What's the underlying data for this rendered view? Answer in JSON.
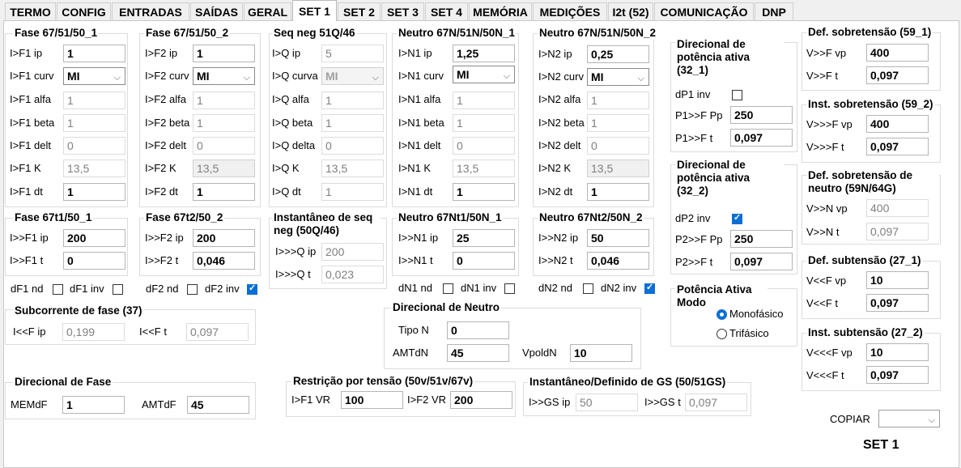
{
  "tabs": [
    "TERMO",
    "CONFIG",
    "ENTRADAS",
    "SAÍDAS",
    "GERAL",
    "SET 1",
    "SET 2",
    "SET 3",
    "SET 4",
    "MEMÓRIA",
    "MEDIÇÕES",
    "I2t (52)",
    "COMUNICAÇÃO",
    "DNP"
  ],
  "active_tab": "SET 1",
  "groups": {
    "f1": {
      "title": "Fase 67/51/50_1",
      "rows": [
        [
          "I>F1 ip",
          "1"
        ],
        [
          "I>F1 curv",
          "MI"
        ],
        [
          "I>F1 alfa",
          "1"
        ],
        [
          "I>F1 beta",
          "1"
        ],
        [
          "I>F1 delt",
          "0"
        ],
        [
          "I>F1 K",
          "13,5"
        ],
        [
          "I>F1 dt",
          "1"
        ]
      ]
    },
    "f2": {
      "title": "Fase 67/51/50_2",
      "rows": [
        [
          "I>F2 ip",
          "1"
        ],
        [
          "I>F2 curv",
          "MI"
        ],
        [
          "I>F2 alfa",
          "1"
        ],
        [
          "I>F2 beta",
          "1"
        ],
        [
          "I>F2 delt",
          "0"
        ],
        [
          "I>F2 K",
          "13,5"
        ],
        [
          "I>F2 dt",
          "1"
        ]
      ]
    },
    "q": {
      "title": "Seq neg 51Q/46",
      "rows": [
        [
          "I>Q ip",
          "5"
        ],
        [
          "I>Q curva",
          "MI"
        ],
        [
          "I>Q alfa",
          "1"
        ],
        [
          "I>Q beta",
          "1"
        ],
        [
          "I>Q delta",
          "0"
        ],
        [
          "I>Q K",
          "13,5"
        ],
        [
          "I>Q dt",
          "1"
        ]
      ]
    },
    "n1": {
      "title": "Neutro 67N/51N/50N_1",
      "rows": [
        [
          "I>N1 ip",
          "1,25"
        ],
        [
          "I>N1 curv",
          "MI"
        ],
        [
          "I>N1 alfa",
          "1"
        ],
        [
          "I>N1 beta",
          "1"
        ],
        [
          "I>N1 delt",
          "0"
        ],
        [
          "I>N1 K",
          "13,5"
        ],
        [
          "I>N1 dt",
          "1"
        ]
      ]
    },
    "n2": {
      "title": "Neutro 67N/51N/50N_2",
      "rows": [
        [
          "I>N2 ip",
          "0,25"
        ],
        [
          "I>N2 curv",
          "MI"
        ],
        [
          "I>N2 alfa",
          "1"
        ],
        [
          "I>N2 beta",
          "1"
        ],
        [
          "I>N2 delt",
          "0"
        ],
        [
          "I>N2 K",
          "13,5"
        ],
        [
          "I>N2 dt",
          "1"
        ]
      ]
    },
    "ft1": {
      "title": "Fase 67t1/50_1",
      "rows": [
        [
          "I>>F1 ip",
          "200"
        ],
        [
          "I>>F1 t",
          "0"
        ]
      ]
    },
    "ft2": {
      "title": "Fase 67t2/50_2",
      "rows": [
        [
          "I>>F2 ip",
          "200"
        ],
        [
          "I>>F2 t",
          "0,046"
        ]
      ]
    },
    "qi": {
      "title": "Instantâneo de seq neg (50Q/46)",
      "rows": [
        [
          "I>>>Q ip",
          "200"
        ],
        [
          "I>>>Q t",
          "0,023"
        ]
      ]
    },
    "nt1": {
      "title": "Neutro 67Nt1/50N_1",
      "rows": [
        [
          "I>>N1 ip",
          "25"
        ],
        [
          "I>>N1 t",
          "0"
        ]
      ]
    },
    "nt2": {
      "title": "Neutro 67Nt2/50N_2",
      "rows": [
        [
          "I>>N2 ip",
          "50"
        ],
        [
          "I>>N2 t",
          "0,046"
        ]
      ]
    },
    "dp1": {
      "title": "Direcional de potência ativa (32_1)",
      "chk": "dP1 inv",
      "rows": [
        [
          "P1>>F Pp",
          "250"
        ],
        [
          "P1>>F t",
          "0,097"
        ]
      ]
    },
    "dp2": {
      "title": "Direcional de potência ativa (32_2)",
      "chk": "dP2 inv",
      "rows": [
        [
          "P2>>F Pp",
          "250"
        ],
        [
          "P2>>F t",
          "0,097"
        ]
      ]
    },
    "pam": {
      "title": "Potência Ativa Modo",
      "opt1": "Monofásico",
      "opt2": "Trifásico"
    },
    "s591": {
      "title": "Def. sobretensão (59_1)",
      "rows": [
        [
          "V>>F vp",
          "400"
        ],
        [
          "V>>F t",
          "0,097"
        ]
      ]
    },
    "s592": {
      "title": "Inst. sobretensão (59_2)",
      "rows": [
        [
          "V>>>F vp",
          "400"
        ],
        [
          "V>>>F t",
          "0,097"
        ]
      ]
    },
    "s59n": {
      "title": "Def. sobretensão de neutro (59N/64G)",
      "rows": [
        [
          "V>>N vp",
          "400"
        ],
        [
          "V>>N t",
          "0,097"
        ]
      ]
    },
    "s271": {
      "title": "Def. subtensão (27_1)",
      "rows": [
        [
          "V<<F vp",
          "10"
        ],
        [
          "V<<F t",
          "0,097"
        ]
      ]
    },
    "s272": {
      "title": "Inst. subtensão (27_2)",
      "rows": [
        [
          "V<<<F vp",
          "10"
        ],
        [
          "V<<<F t",
          "0,097"
        ]
      ]
    },
    "sub37": {
      "title": "Subcorrente de fase (37)",
      "a_lbl": "I<<F ip",
      "a_val": "0,199",
      "b_lbl": "I<<F t",
      "b_val": "0,097"
    },
    "dirn": {
      "title": "Direcional de Neutro",
      "tipo_lbl": "Tipo N",
      "tipo_val": "0",
      "amt_lbl": "AMTdN",
      "amt_val": "45",
      "vp_lbl": "VpoldN",
      "vp_val": "10"
    },
    "dirf": {
      "title": "Direcional de Fase",
      "mem_lbl": "MEMdF",
      "mem_val": "1",
      "amt_lbl": "AMTdF",
      "amt_val": "45"
    },
    "restr": {
      "title": "Restrição por tensão (50v/51v/67v)",
      "a_lbl": "I>F1 VR",
      "a_val": "100",
      "b_lbl": "I>F2 VR",
      "b_val": "200"
    },
    "gs": {
      "title": "Instantâneo/Definido de GS (50/51GS)",
      "a_lbl": "I>>GS ip",
      "a_val": "50",
      "b_lbl": "I>>GS t",
      "b_val": "0,097"
    }
  },
  "checks": {
    "dF1nd": "dF1 nd",
    "dF1inv": "dF1 inv",
    "dF2nd": "dF2 nd",
    "dF2inv": "dF2 inv",
    "dN1nd": "dN1 nd",
    "dN1inv": "dN1 inv",
    "dN2nd": "dN2 nd",
    "dN2inv": "dN2 inv"
  },
  "copiar_label": "COPIAR",
  "set_label": "SET 1"
}
